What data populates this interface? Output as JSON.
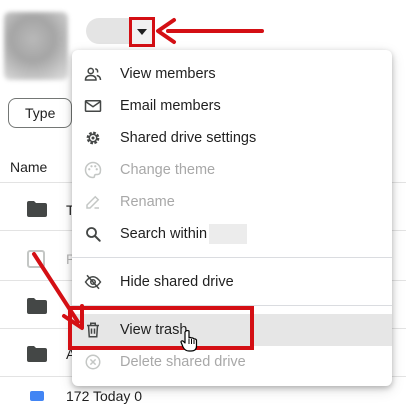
{
  "header": {
    "drive_name_redacted": true
  },
  "filters": {
    "type_label": "Type"
  },
  "list": {
    "column_name": "Name",
    "rows": [
      {
        "label": "T",
        "icon": "folder-icon"
      },
      {
        "label": "P",
        "icon": "shortcut-icon"
      },
      {
        "label": "",
        "icon": "folder-icon"
      },
      {
        "label": "A",
        "icon": "folder-icon"
      }
    ],
    "bottom_item": "172 Today 0"
  },
  "menu": {
    "items": [
      {
        "label": "View members",
        "icon": "people-icon",
        "enabled": true
      },
      {
        "label": "Email members",
        "icon": "mail-icon",
        "enabled": true
      },
      {
        "label": "Shared drive settings",
        "icon": "gear-icon",
        "enabled": true
      },
      {
        "label": "Change theme",
        "icon": "palette-icon",
        "enabled": false
      },
      {
        "label": "Rename",
        "icon": "pencil-icon",
        "enabled": false
      },
      {
        "label": "Search within",
        "icon": "search-icon",
        "enabled": true
      },
      {
        "label": "Hide shared drive",
        "icon": "eye-off-icon",
        "enabled": true
      },
      {
        "label": "View trash",
        "icon": "trash-icon",
        "enabled": true,
        "hovered": true
      },
      {
        "label": "Delete shared drive",
        "icon": "delete-circle-icon",
        "enabled": false
      }
    ]
  },
  "annotation_color": "#d40f14"
}
